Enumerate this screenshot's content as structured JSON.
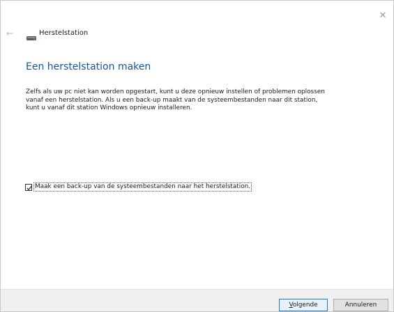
{
  "window": {
    "title": "Herstelstation",
    "close_glyph": "✕",
    "back_glyph": "←"
  },
  "main": {
    "heading": "Een herstelstation maken",
    "description_lines": [
      "Zelfs als uw pc niet kan worden opgestart, kunt u deze opnieuw instellen of problemen oplossen",
      "vanaf een herstelstation. Als u een back-up maakt van de systeembestanden naar dit station,",
      "kunt u vanaf dit station Windows opnieuw installeren."
    ],
    "backup_checkbox": {
      "label": "Maak een back-up van de systeembestanden naar het herstelstation.",
      "checked": true
    }
  },
  "footer": {
    "next_key": "V",
    "next_rest": "olgende",
    "cancel_label": "Annuleren"
  },
  "colors": {
    "heading": "#15539e",
    "footer_bg": "#f0f0f0",
    "default_button_border": "#2a72c8"
  },
  "icons": {
    "title_icon": "drive-icon",
    "close": "close-icon",
    "back": "back-arrow-icon",
    "check": "checkmark-icon"
  }
}
